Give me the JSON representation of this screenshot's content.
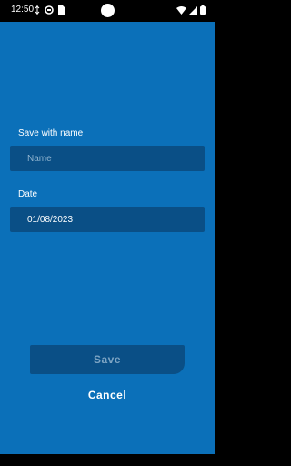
{
  "status_bar": {
    "time": "12:50",
    "left_icons": [
      "data-saver-icon",
      "vpn-icon",
      "sim-card-icon"
    ],
    "right_icons": [
      "wifi-icon",
      "signal-icon",
      "battery-icon"
    ]
  },
  "form": {
    "name_label": "Save with name",
    "name_placeholder": "Name",
    "date_label": "Date",
    "date_value": "01/08/2023"
  },
  "actions": {
    "save_label": "Save",
    "cancel_label": "Cancel"
  },
  "colors": {
    "background": "#0b70b9",
    "field_background": "#0a4f86",
    "text": "#ffffff",
    "placeholder": "#8fb3cf",
    "disabled_button_text": "#7ea5c4"
  }
}
